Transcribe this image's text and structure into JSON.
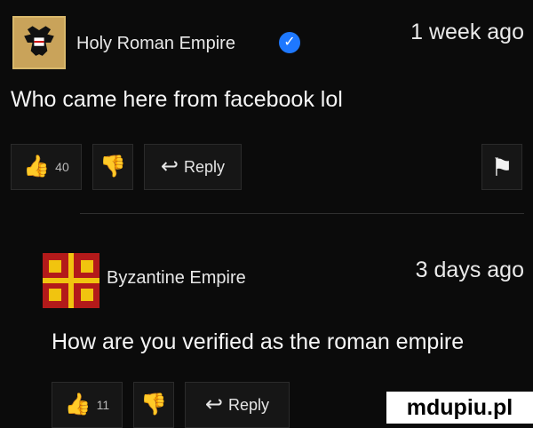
{
  "comments": [
    {
      "username": "Holy Roman Empire",
      "verified_icon": "checkmark-badge-icon",
      "time": "1 week ago",
      "text": "Who came here from facebook lol",
      "likes": "40",
      "reply_label": "Reply",
      "avatar_icon": "double-headed-eagle-icon"
    },
    {
      "username": "Byzantine Empire",
      "time": "3 days ago",
      "text": "How are you verified as the roman empire",
      "likes": "11",
      "reply_label": "Reply",
      "avatar_icon": "tetragrammatic-cross-flag-icon"
    }
  ],
  "watermark": "mdupiu.pl",
  "colors": {
    "background": "#0b0b0b",
    "verified": "#1e78ff",
    "byzantine_red": "#b31a1a",
    "byzantine_gold": "#f1c40f"
  }
}
